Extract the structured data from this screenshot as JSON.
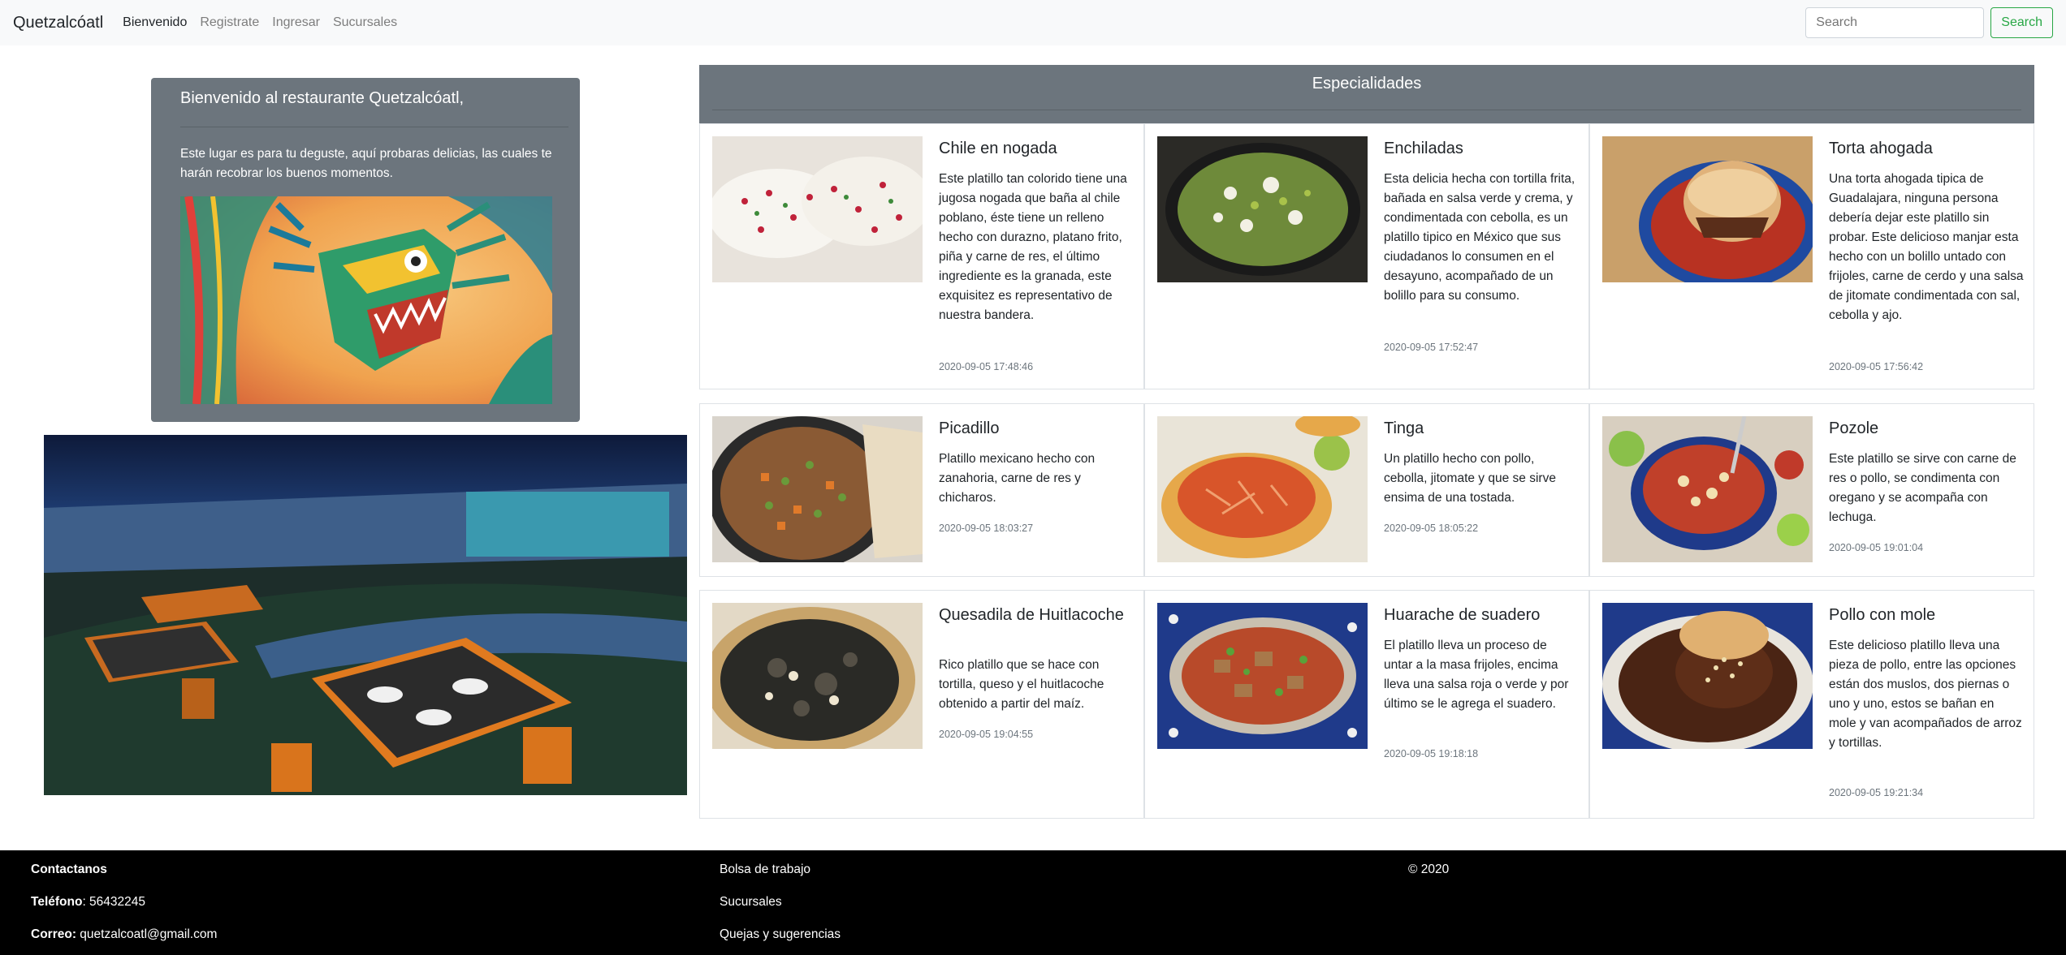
{
  "navbar": {
    "brand": "Quetzalcóatl",
    "links": [
      "Bienvenido",
      "Registrate",
      "Ingresar",
      "Sucursales"
    ],
    "search_placeholder": "Search",
    "search_button": "Search"
  },
  "welcome": {
    "title": "Bienvenido al restaurante Quetzalcóatl,",
    "text": "Este lugar es para tu deguste, aquí probaras delicias, las cuales te harán recobrar los buenos momentos."
  },
  "specialties": {
    "title": "Especialidades",
    "dishes": [
      {
        "name": "Chile en nogada",
        "description": "Este platillo tan colorido tiene una jugosa nogada que baña al chile poblano, éste tiene un relleno hecho con durazno, platano frito, piña y carne de res, el último ingrediente es la granada, este exquisitez es representativo de nuestra bandera.",
        "date": "2020-09-05 17:48:46"
      },
      {
        "name": "Enchiladas",
        "description": "Esta delicia hecha con tortilla frita, bañada en salsa verde y crema, y condimentada con cebolla, es un platillo tipico en México que sus ciudadanos lo consumen en el desayuno, acompañado de un bolillo para su consumo.",
        "date": "2020-09-05 17:52:47"
      },
      {
        "name": "Torta ahogada",
        "description": "Una torta ahogada tipica de Guadalajara, ninguna persona debería dejar este platillo sin probar. Este delicioso manjar esta hecho con un bolillo untado con frijoles, carne de cerdo y una salsa de jitomate condimentada con sal, cebolla y ajo.",
        "date": "2020-09-05 17:56:42"
      },
      {
        "name": "Picadillo",
        "description": "Platillo mexicano hecho con zanahoria, carne de res y chicharos.",
        "date": "2020-09-05 18:03:27"
      },
      {
        "name": "Tinga",
        "description": "Un platillo hecho con pollo, cebolla, jitomate y que se sirve ensima de una tostada.",
        "date": "2020-09-05 18:05:22"
      },
      {
        "name": "Pozole",
        "description": "Este platillo se sirve con carne de res o pollo, se condimenta con oregano y se acompaña con lechuga.",
        "date": "2020-09-05 19:01:04"
      },
      {
        "name": "Quesadila de Huitlacoche",
        "description": "Rico platillo que se hace con tortilla, queso y el huitlacoche obtenido a partir del maíz.",
        "date": "2020-09-05 19:04:55"
      },
      {
        "name": "Huarache de suadero",
        "description": "El platillo lleva un proceso de untar a la masa frijoles, encima lleva una salsa roja o verde y por último se le agrega el suadero.",
        "date": "2020-09-05 19:18:18"
      },
      {
        "name": "Pollo con mole",
        "description": "Este delicioso platillo lleva una pieza de pollo, entre las opciones están dos muslos, dos piernas o uno y uno, estos se bañan en mole y van acompañados de arroz y tortillas.",
        "date": "2020-09-05 19:21:34"
      }
    ]
  },
  "footer": {
    "contact_heading": "Contactanos",
    "phone_label": "Teléfono",
    "phone_value": ": 56432245",
    "email_label": "Correo:",
    "email_value": " quetzalcoatl@gmail.com",
    "links": [
      "Bolsa de trabajo",
      "Sucursales",
      "Quejas y sugerencias"
    ],
    "copyright": "© 2020"
  },
  "colors": {
    "navbar_bg": "#f8f9fa",
    "card_gray": "#6c757d",
    "search_green": "#28a745",
    "footer_bg": "#000000"
  }
}
